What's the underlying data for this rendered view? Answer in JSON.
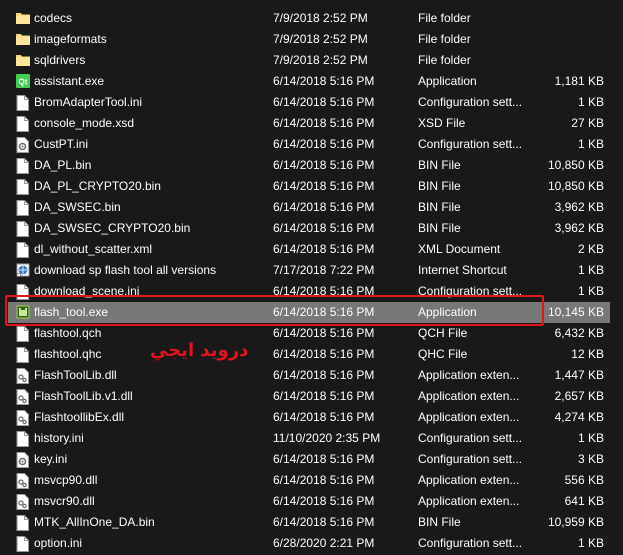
{
  "colors": {
    "folder": "#f8d775",
    "highlight": "#e1141b",
    "selected_row": "#777777",
    "background": "#191919"
  },
  "files": [
    {
      "name": "codecs",
      "date": "7/9/2018 2:52 PM",
      "type": "File folder",
      "size": "",
      "icon": "folder-icon"
    },
    {
      "name": "imageformats",
      "date": "7/9/2018 2:52 PM",
      "type": "File folder",
      "size": "",
      "icon": "folder-icon"
    },
    {
      "name": "sqldrivers",
      "date": "7/9/2018 2:52 PM",
      "type": "File folder",
      "size": "",
      "icon": "folder-icon"
    },
    {
      "name": "assistant.exe",
      "date": "6/14/2018 5:16 PM",
      "type": "Application",
      "size": "1,181 KB",
      "icon": "qt-app-icon"
    },
    {
      "name": "BromAdapterTool.ini",
      "date": "6/14/2018 5:16 PM",
      "type": "Configuration sett...",
      "size": "1 KB",
      "icon": "file-icon"
    },
    {
      "name": "console_mode.xsd",
      "date": "6/14/2018 5:16 PM",
      "type": "XSD File",
      "size": "27 KB",
      "icon": "file-icon"
    },
    {
      "name": "CustPT.ini",
      "date": "6/14/2018 5:16 PM",
      "type": "Configuration sett...",
      "size": "1 KB",
      "icon": "settings-file-icon"
    },
    {
      "name": "DA_PL.bin",
      "date": "6/14/2018 5:16 PM",
      "type": "BIN File",
      "size": "10,850 KB",
      "icon": "file-icon"
    },
    {
      "name": "DA_PL_CRYPTO20.bin",
      "date": "6/14/2018 5:16 PM",
      "type": "BIN File",
      "size": "10,850 KB",
      "icon": "file-icon"
    },
    {
      "name": "DA_SWSEC.bin",
      "date": "6/14/2018 5:16 PM",
      "type": "BIN File",
      "size": "3,962 KB",
      "icon": "file-icon"
    },
    {
      "name": "DA_SWSEC_CRYPTO20.bin",
      "date": "6/14/2018 5:16 PM",
      "type": "BIN File",
      "size": "3,962 KB",
      "icon": "file-icon"
    },
    {
      "name": "dl_without_scatter.xml",
      "date": "6/14/2018 5:16 PM",
      "type": "XML Document",
      "size": "2 KB",
      "icon": "file-icon"
    },
    {
      "name": "download sp flash tool all versions",
      "date": "7/17/2018 7:22 PM",
      "type": "Internet Shortcut",
      "size": "1 KB",
      "icon": "internet-shortcut-icon"
    },
    {
      "name": "download_scene.ini",
      "date": "6/14/2018 5:16 PM",
      "type": "Configuration sett...",
      "size": "1 KB",
      "icon": "file-icon"
    },
    {
      "name": "flash_tool.exe",
      "date": "6/14/2018 5:16 PM",
      "type": "Application",
      "size": "10,145 KB",
      "icon": "flash-tool-app-icon",
      "selected": true
    },
    {
      "name": "flashtool.qch",
      "date": "6/14/2018 5:16 PM",
      "type": "QCH File",
      "size": "6,432 KB",
      "icon": "file-icon"
    },
    {
      "name": "flashtool.qhc",
      "date": "6/14/2018 5:16 PM",
      "type": "QHC File",
      "size": "12 KB",
      "icon": "file-icon"
    },
    {
      "name": "FlashToolLib.dll",
      "date": "6/14/2018 5:16 PM",
      "type": "Application exten...",
      "size": "1,447 KB",
      "icon": "dll-icon"
    },
    {
      "name": "FlashToolLib.v1.dll",
      "date": "6/14/2018 5:16 PM",
      "type": "Application exten...",
      "size": "2,657 KB",
      "icon": "dll-icon"
    },
    {
      "name": "FlashtoollibEx.dll",
      "date": "6/14/2018 5:16 PM",
      "type": "Application exten...",
      "size": "4,274 KB",
      "icon": "dll-icon"
    },
    {
      "name": "history.ini",
      "date": "11/10/2020 2:35 PM",
      "type": "Configuration sett...",
      "size": "1 KB",
      "icon": "file-icon"
    },
    {
      "name": "key.ini",
      "date": "6/14/2018 5:16 PM",
      "type": "Configuration sett...",
      "size": "3 KB",
      "icon": "settings-file-icon"
    },
    {
      "name": "msvcp90.dll",
      "date": "6/14/2018 5:16 PM",
      "type": "Application exten...",
      "size": "556 KB",
      "icon": "dll-icon"
    },
    {
      "name": "msvcr90.dll",
      "date": "6/14/2018 5:16 PM",
      "type": "Application exten...",
      "size": "641 KB",
      "icon": "dll-icon"
    },
    {
      "name": "MTK_AllInOne_DA.bin",
      "date": "6/14/2018 5:16 PM",
      "type": "BIN File",
      "size": "10,959 KB",
      "icon": "file-icon"
    },
    {
      "name": "option.ini",
      "date": "6/28/2020 2:21 PM",
      "type": "Configuration sett...",
      "size": "1 KB",
      "icon": "file-icon"
    }
  ],
  "annotation": {
    "text": "درويد ايجي"
  }
}
